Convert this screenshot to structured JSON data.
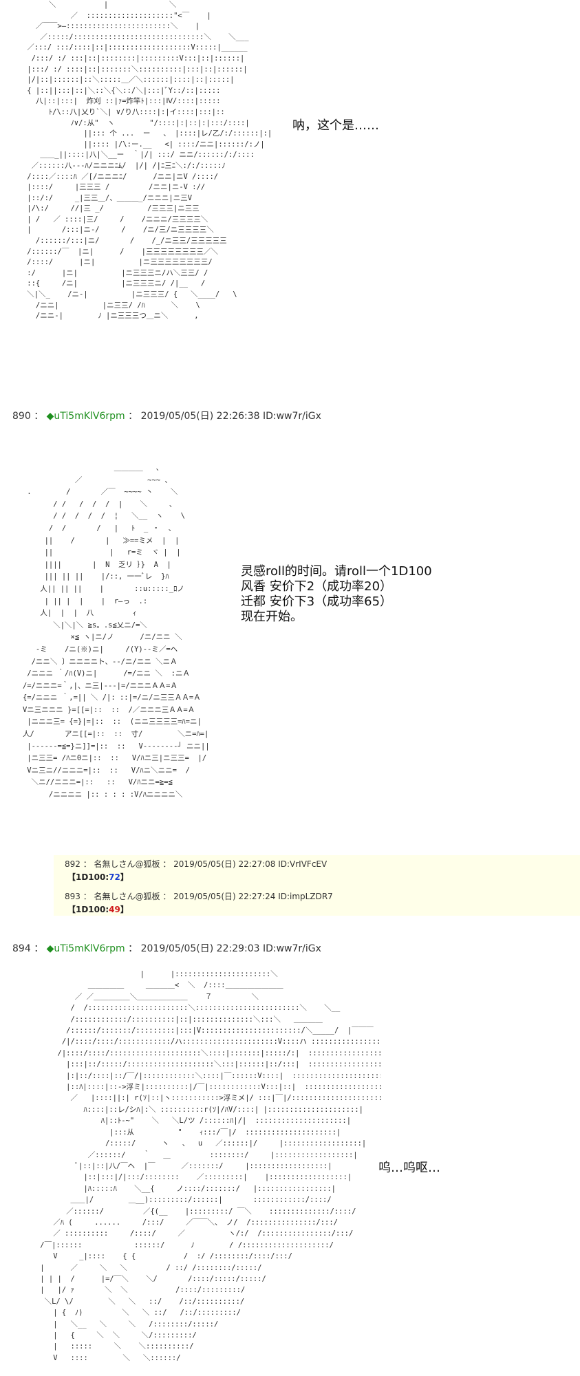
{
  "panel1": {
    "art": "         ＼           |              ＼\n              ／  ::::::::::::::::::::\"<￣    |\n      ／￣￣>―::::::::::::::::::::::::＼    |\n       ／:::::/::::::::::::::::::::::::::::::＼    ＼___\n    ／:::/ :::/::::|::|:::::::::::::::::::V:::::|______\n     /:::/ :/ :::|::|::::::::|:::::::::V:::|::|::::::|\n    |:::/ :/ ::::|::|:::::::＼::::::::::|:::|::|::::::|\n    |/|::|::::::|::＼:::::＿／＼::::::|::::|::|:::::|\n    { |::||:::|::|＼::＼{＼::/＼|:::|ﾞY::/::|:::::\n      八|::|:::|  炸刈 ::|ｧ=炸竿ﾄ|:::|Ⅳ/::::|:::::\n         ﾄ/\\::八|乂り`＼| ∨/り八::::|:|イ::::|:::|::\n              ﾉ∨/:从\"  ヽ        \"/::::|:|::|:|:::/::::|\n                 ||::: 个 ...  ー   、 |::::|レ/乙/:/::::::|:|\n                 ||:::: |/\\:ー.__   <| ::::/ニニ|::::::/:ノ|\n       ＿＿_||::::|八|＼__ー  ｀|/| :::/ ニニ/::::::/:/::::\n     ／::::::八---ﾊ/ニニニﾆﾑ/  |/| /|ﾆ三ﾆ＼:/:/:::::ﾉ\n    /::::／::::ﾊ ／[/ニニニﾆ/      /ニニ|ニV /::::/\n    |::::/     |三三三 /         /ニニ|ニ-V ://\n    |::/:/     _|三三＿/、＿＿＿_/ニニニ|ニ三V\n    |/\\:/     //|三 _/          /三三三|ニ三三\n    | /   ／ ::::|三/     /    /ニニニ/三三三三＼\n    |       /:::|ニ-/     /    /ニ/三/ニ三三三三＼\n      /::::::/:::|ニ/       /    /_/ニ三三/三三三三三\n    /::::::/￣  |ニ|      /    |三三三三三三三三／＼\n    /::::/      |ニ|          |ニ三三三三三三三三/   \n    :/      |ニ|          |ニ三三三ニ/ハ＼三三/ /\n    ::{     /ニ|          |ニ三三三ニ/ /|__   /   \n    ＼|＼_    /ニ-|          |ニ三三三/ {   ＼____/   \\  \n      /ニニ|          |ニ三三/ /ﾊ      ＼    \\\n      /ニニ-|        ﾉ |ニ三三三つ＿ニ＼      ,",
    "speech": "呐，这个是…… "
  },
  "post890": {
    "number": "890",
    "colon": "：",
    "diamond": "◆",
    "trip": "uTi5mKlV6rpm",
    "date_sep": "：",
    "datetime": "2019/05/05(日) 22:26:38 ID:ww7r/iGx"
  },
  "panel2": {
    "art": "                        ＿＿＿＿   、\n               ／               ~~~ 、       \n    .        /       ／￣  ~~~~ 丶    ＼   \n          / /   /  /  /  |    ＼     、   \n          / /  /  /  /  ¦   ＼__  ヽ    \\  \n         /  /       /   |   ﾄ  _ ・  、   \n        ||    /       |   ≫==ミメ  |  |  \n        ||             |   r=ミ  ヾ |  |  \n        ||||       |  N  乏リ ｝}  A  | \n        ||| || ||    |/::, 一一ﾞレ  }ﾊ  \n       人|| || ||    |       ::u:::::_ﾛノ\n        | || |  |    |  r―っ  .:\n       人|  |  |  八         ｨ\n          ＼|＼|＼ ≧s。.s≦乂ニ/=＼\n              ×≦ ヽ|ニ/ノ      /ニ/ニニ ＼\n      -ミ    /ニ(※)ニ|     /(Y)--ミ／=ヘ\n     /ニニ＼ 〕ニニニニト、--/ニ/ニニ ＼ニＡ\n    /ニニニ ｀/ﾊ(V)ニ|      /=/ニニ ＼  :ニＡ\n   /=/ニニニ=｀,|、ニ三|---|=/ニニニＡＡ=Ａ\n   {=/ニニニ ｀,=|| ＼ /|: ::|=/ニ/ニ三三ＡＡ=Ａ\n   Vニ三ニニニ }=[[=|::  ::  /／ニニニ三ＡＡ=Ａ\n    |ニニニ三= {=}|=|::  ::  (ニニ三三三三=ﾊ=ニ|\n   人/       アニ[[=|::  ::  寸/        ＼ニ=ﾊ=|\n    |------=≦=}ニ]]=|::  ::   V--------┘ ニニ||\n    |ニ三三= /ﾊニ0ニ|::  ::   V/ﾊニ三|ニ三三=  |/\n    Vニ三ニ//ニニニ=|::  ::   V/ﾊニ＼ニニ=  /\n     ＼ニ//ニニニ=|::   ::   V/ﾊニニ=≧=≦\n         /ニニニニ |:: : : : :V/ﾊニニニニ＼",
    "speech": "灵感roll的时间。请roll一个1D100\n风香 安价下2（成功率20）\n迁都 安价下3（成功率65）\n现在开始。"
  },
  "replies": [
    {
      "header": "892 ： 名無しさん@狐板 ： 2019/05/05(日) 22:27:08 ID:VrIVFcEV",
      "dice_label": "【1D100:",
      "dice_value": "72",
      "dice_close": "】"
    },
    {
      "header": "893 ： 名無しさん@狐板 ： 2019/05/05(日) 22:27:24 ID:impLZDR7",
      "dice_label": "【1D100:",
      "dice_value": "49",
      "dice_close": "】"
    }
  ],
  "post894": {
    "number": "894",
    "colon": "：",
    "diamond": "◆",
    "trip": "uTi5mKlV6rpm",
    "date_sep": "：",
    "datetime": "2019/05/05(日) 22:29:03 ID:ww7r/iGx"
  },
  "panel3": {
    "art": "                              |      |::::::::::::::::::::::＼\n                  ＿＿＿＿＿     ＿＿＿＿<  ＼  /::::＿＿＿＿＿＿＿＿\n               ／ ／＿＿＿＿＿＼＿＿＿＿＿＿＿    ７         ＼\n              /  /:::::::::::::::::::::::＼::::::::::::::::::::::::＼    ＼__\n              /::::::::::::/::::::::::|::|::::::::::::::＼:::＼   ＿＿＿＿\n             /::::::/:::::::/:::::::::|:::|V:::::::::::::::::::::::/＼_____/  |￣￣￣\n            /|/::::/::::/::::::::::::/ハ::::::::::::::::::::::V::::ハ :::::::::::::::::: |\n           /|::::/::::/:::::::::::::::::::::＼::::|:::::::|:::::/:|  ::::::::::::::::::: |\n             |:::|::/:::::/::::::::::::::::::::＼:::|::::::|::/:::|  :::::::::::::::::::: |\n             |:|::/::::|::/￣/|::::::::::::＼::::|￣::::::V::::|  ::::::::::::::::::::: |\n             |::ﾊ|::::|::->浮ミ|::::::::::|/￣|::::::::::::V:::|::|  ::::::::::::::::::::: |\n              ／   |::::||:| r(ｿ|::|ヽ:::::::::::>浮ミメ|/ :::|￣|/::::::::::::::::::::::|\n                 ﾊ::::|::レ/シﾊ|:＼ ::::::::::r(ｿ|/ﾊV/::::| |:::::::::::::::::::::|\n                     ﾊ|::ﾄ-~\"    ＼   ＼L/ツ /::::::ﾊ|/|  :::::::::::::::::::::|\n                       |:::从          \"    ｨ:::/￣|/  :::::::::::::::::::::|\n                      /:::::/      ヽ   、  u   ／::::::|/     |::::::::::::::::::|\n                  ／::::::/    ｀   ＿         ::::::::/     |::::::::::::::::::|\n               ﾞ|::|::|八/￣ヘ  |￣      ／:::::::/     |::::::::::::::::::|\n                 |::|:::|/|:::/::::::::    ／:::::::::|    |::::::::::::::::::|\n                 |ﾊ:::::ﾊ    ＼__{     ノ::::/:::::::/   |:::::::::::::::::|\n              ＿＿|/        ＿__):::::::::/::::::|       ::::::::::::/::::/\n             ／::::::/         ／{(__    |:::::::::/ ￣＼    ::::::::::::::/::::/\n          ／ﾊ (     ......     /:::/     ／￣￣＼、 ノ/  /:::::::::::::::/:::/\n          ／ ::::::::::     /::::/     ／          ヽ/:/  /::::::::::::::::/:::/\n       /￣|::::::            ::::::/      ﾉ        / /::::::::::::::::::::/\n          V     _|::::    { {           /  :/ /::::::::/::::/:::/\n       |      ／     ＼   ＼         / ::/ /::::::::/:::::/\n       | | |  /      |=/￣＼    ＼/       /::::/:::::/:::::/\n       |   |/ ｧ       ＼  ＼           /::::/:::::::::/\n        ＼L/ \\/        ＼   ＼   ::/    /::/::::::::::/\n          | {  ﾉ)         ＼   ＼ ::/   /::/:::::::::/\n          |   ＼__   ＼     ＼   /::::::::/:::::/\n          |   {     ＼  ＼     ＼/:::::::::/\n          |   :::::     ＼    ＼::::::::::/\n          V   ::::        ＼   ＼::::::/",
    "speech": "呜…呜呕…"
  }
}
